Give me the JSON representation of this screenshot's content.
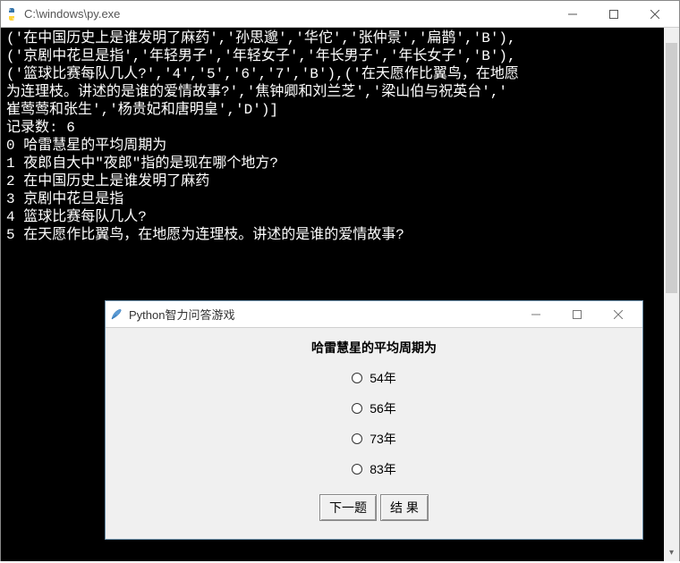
{
  "main_window": {
    "title": "C:\\windows\\py.exe"
  },
  "console": {
    "lines": [
      "('在中国历史上是谁发明了麻药','孙思邈','华佗','张仲景','扁鹊','B'),",
      "('京剧中花旦是指','年轻男子','年轻女子','年长男子','年长女子','B'),",
      "('篮球比赛每队几人?','4','5','6','7','B'),('在天愿作比翼鸟，在地愿",
      "为连理枝。讲述的是谁的爱情故事?','焦钟卿和刘兰芝','梁山伯与祝英台','",
      "崔莺莺和张生','杨贵妃和唐明皇','D')]",
      "记录数: 6",
      "0 哈雷慧星的平均周期为",
      "1 夜郎自大中\"夜郎\"指的是现在哪个地方?",
      "2 在中国历史上是谁发明了麻药",
      "3 京剧中花旦是指",
      "4 篮球比赛每队几人?",
      "5 在天愿作比翼鸟，在地愿为连理枝。讲述的是谁的爱情故事?"
    ]
  },
  "dialog": {
    "title": "Python智力问答游戏",
    "question": "哈雷慧星的平均周期为",
    "options": [
      "54年",
      "56年",
      "73年",
      "83年"
    ],
    "buttons": {
      "next": "下一题",
      "result": "结 果"
    }
  }
}
